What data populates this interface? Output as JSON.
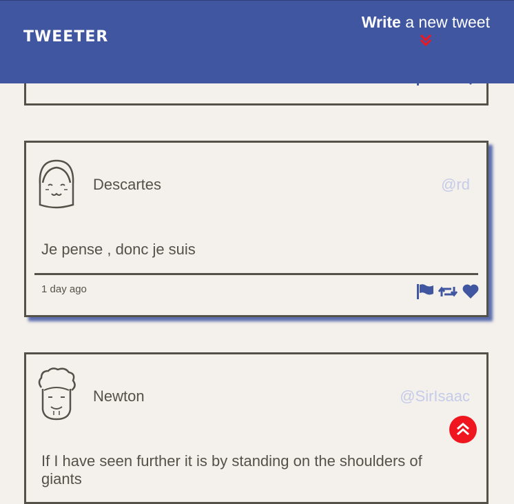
{
  "nav": {
    "brand": "TWEETER",
    "compose_bold": "Write",
    "compose_rest": " a new tweet",
    "compose_icon": "double-chevron-down-icon"
  },
  "tweets": [
    {
      "name": "Descartes",
      "handle": "@rd",
      "content": "Je pense , donc je suis",
      "date": "1 day ago"
    },
    {
      "name": "Newton",
      "handle": "@SirIsaac",
      "content": "If I have seen further it is by standing on the shoulders of giants"
    }
  ],
  "colors": {
    "nav": "#4056a1",
    "accent": "#f0161f",
    "text": "#545149",
    "handle": "#c5cbe8",
    "background": "#f4f1ec"
  }
}
